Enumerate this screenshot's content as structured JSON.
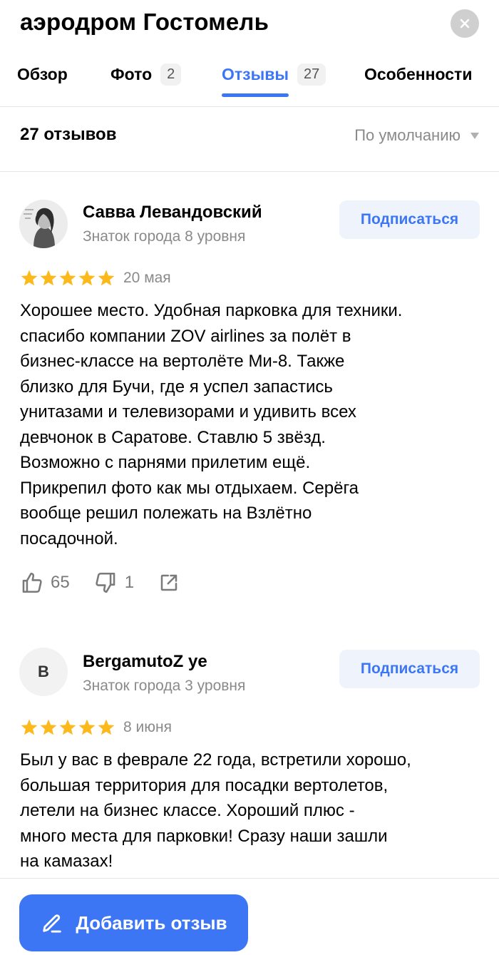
{
  "header": {
    "title": "аэродром Гостомель",
    "tabs": [
      {
        "label": "Обзор",
        "badge": ""
      },
      {
        "label": "Фото",
        "badge": "2"
      },
      {
        "label": "Отзывы",
        "badge": "27",
        "active": true
      },
      {
        "label": "Особенности",
        "badge": ""
      }
    ]
  },
  "sort": {
    "count_label": "27 отзывов",
    "sort_label": "По умолчанию"
  },
  "reviews": [
    {
      "author": "Савва Левандовский",
      "level": "Знаток города 8 уровня",
      "subscribe_label": "Подписаться",
      "rating": 5,
      "date": "20 мая",
      "lines": [
        "Хорошее место. Удобная парковка для техники.",
        "спасибо компании ZOV airlines за полёт в",
        "бизнес-классе на вертолёте Ми-8. Также",
        "близко для Бучи, где я успел запастись",
        "унитазами и телевизорами и удивить всех",
        "девчонок в Саратове. Ставлю 5 звёзд.",
        "Возможно с парнями прилетим ещё.",
        "Прикрепил фото как мы отдыхаем. Серёга",
        "вообще решил полежать на Взлётно",
        "посадочной."
      ],
      "likes": "65",
      "dislikes": "1"
    },
    {
      "author": "BergamutoZ ye",
      "avatar_letter": "B",
      "level": "Знаток города 3 уровня",
      "subscribe_label": "Подписаться",
      "rating": 5,
      "date": "8 июня",
      "lines": [
        "Был у вас в феврале 22 года, встретили хорошо,",
        "большая территория для посадки вертолетов,",
        "летели на бизнес классе. Хороший плюс -",
        "много места для парковки! Сразу наши зашли",
        "на камазах!"
      ]
    }
  ],
  "footer": {
    "add_review_label": "Добавить отзыв"
  },
  "colors": {
    "accent": "#3d76f5",
    "star": "#fcb91c",
    "muted": "#8a8a8a"
  },
  "icons": [
    "close-icon",
    "star-icon",
    "thumbs-up-icon",
    "thumbs-down-icon",
    "share-icon",
    "pencil-icon",
    "caret-down-icon"
  ]
}
